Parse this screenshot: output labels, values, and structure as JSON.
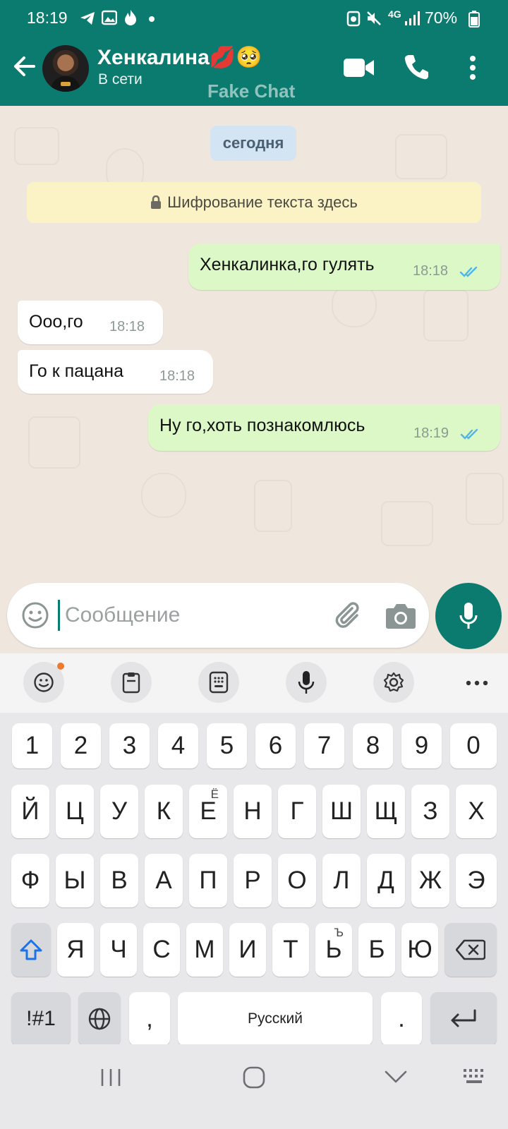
{
  "status_bar": {
    "time": "18:19",
    "network": "4G",
    "battery": "70%"
  },
  "header": {
    "contact_name": "Хенкалина💋🥺",
    "contact_status": "В сети",
    "watermark": "Fake Chat"
  },
  "chat": {
    "date_chip": "сегодня",
    "encryption_notice": "Шифрование текста здесь",
    "messages": [
      {
        "direction": "out",
        "text": "Хенкалинка,го гулять",
        "time": "18:18",
        "status": "read"
      },
      {
        "direction": "in",
        "text": "Ооо,го",
        "time": "18:18"
      },
      {
        "direction": "in",
        "text": "Го к пацана",
        "time": "18:18"
      },
      {
        "direction": "out",
        "text": "Ну го,хоть познакомлюсь",
        "time": "18:19",
        "status": "read"
      }
    ]
  },
  "composer": {
    "placeholder": "Сообщение"
  },
  "keyboard": {
    "row_numbers": [
      "1",
      "2",
      "3",
      "4",
      "5",
      "6",
      "7",
      "8",
      "9",
      "0"
    ],
    "row1": [
      "Й",
      "Ц",
      "У",
      "К",
      "Е",
      "Н",
      "Г",
      "Ш",
      "Щ",
      "З",
      "Х"
    ],
    "row1_alt_e": "Ё",
    "row2": [
      "Ф",
      "Ы",
      "В",
      "А",
      "П",
      "Р",
      "О",
      "Л",
      "Д",
      "Ж",
      "Э"
    ],
    "row3": [
      "Я",
      "Ч",
      "С",
      "М",
      "И",
      "Т",
      "Ь",
      "Б",
      "Ю"
    ],
    "row3_alt_soft": "Ъ",
    "symbols_key": "!#1",
    "comma_key": ",",
    "space_label": "Русский",
    "period_key": "."
  },
  "colors": {
    "header": "#0b7b6f",
    "outgoing_bubble": "#dcf8c6",
    "incoming_bubble": "#ffffff",
    "read_ticks": "#4fb6ec"
  }
}
